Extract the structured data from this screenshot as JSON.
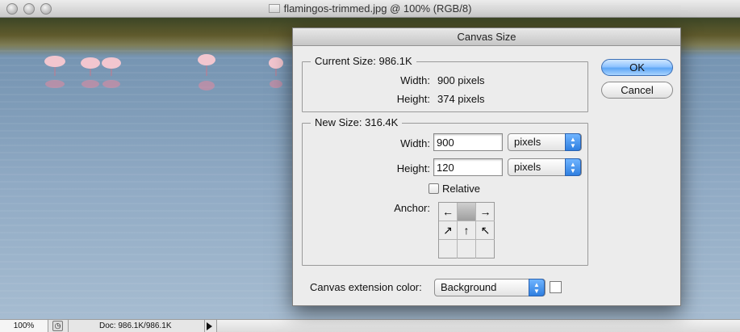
{
  "window": {
    "title": "flamingos-trimmed.jpg @ 100% (RGB/8)"
  },
  "status_bar": {
    "zoom": "100%",
    "doc_info": "Doc: 986.1K/986.1K"
  },
  "dialog": {
    "title": "Canvas Size",
    "current_size": {
      "label": "Current Size: 986.1K",
      "width_label": "Width:",
      "width_value": "900 pixels",
      "height_label": "Height:",
      "height_value": "374 pixels"
    },
    "new_size": {
      "label": "New Size: 316.4K",
      "width_label": "Width:",
      "width_value": "900",
      "width_unit": "pixels",
      "height_label": "Height:",
      "height_value": "120",
      "height_unit": "pixels",
      "relative_label": "Relative",
      "relative_checked": false,
      "anchor_label": "Anchor:",
      "anchor_arrows": [
        "←",
        "",
        "→",
        "↗",
        "↑",
        "↖",
        "",
        "",
        ""
      ]
    },
    "extension_color_label": "Canvas extension color:",
    "extension_color_value": "Background",
    "buttons": {
      "ok": "OK",
      "cancel": "Cancel"
    }
  },
  "colors": {
    "accent": "#5ea6f5",
    "water": "#90aac4"
  }
}
